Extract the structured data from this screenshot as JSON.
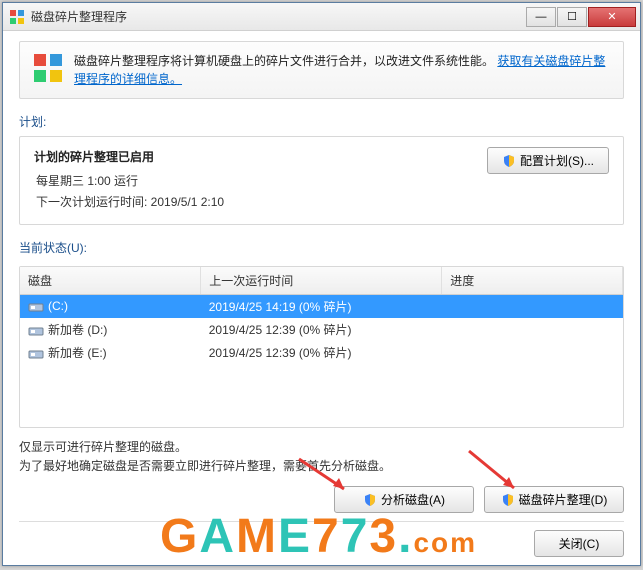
{
  "titlebar": {
    "title": "磁盘碎片整理程序"
  },
  "info": {
    "text_prefix": "磁盘碎片整理程序将计算机硬盘上的碎片文件进行合并，以改进文件系统性能。",
    "link": "获取有关磁盘碎片整理程序的详细信息。"
  },
  "schedule": {
    "label": "计划:",
    "title": "计划的碎片整理已启用",
    "line1": "每星期三  1:00 运行",
    "line2": "下一次计划运行时间: 2019/5/1 2:10",
    "config_btn": "配置计划(S)..."
  },
  "status_label": "当前状态(U):",
  "table": {
    "headers": {
      "disk": "磁盘",
      "lastrun": "上一次运行时间",
      "progress": "进度"
    },
    "rows": [
      {
        "name": "(C:)",
        "lastrun": "2019/4/25 14:19 (0% 碎片)",
        "progress": "",
        "selected": true
      },
      {
        "name": "新加卷 (D:)",
        "lastrun": "2019/4/25 12:39 (0% 碎片)",
        "progress": "",
        "selected": false
      },
      {
        "name": "新加卷 (E:)",
        "lastrun": "2019/4/25 12:39 (0% 碎片)",
        "progress": "",
        "selected": false
      }
    ]
  },
  "footer": {
    "line1": "仅显示可进行碎片整理的磁盘。",
    "line2": "为了最好地确定磁盘是否需要立即进行碎片整理，需要首先分析磁盘。"
  },
  "buttons": {
    "analyze": "分析磁盘(A)",
    "defrag": "磁盘碎片整理(D)",
    "close": "关闭(C)"
  },
  "watermark": "GAME773.com"
}
